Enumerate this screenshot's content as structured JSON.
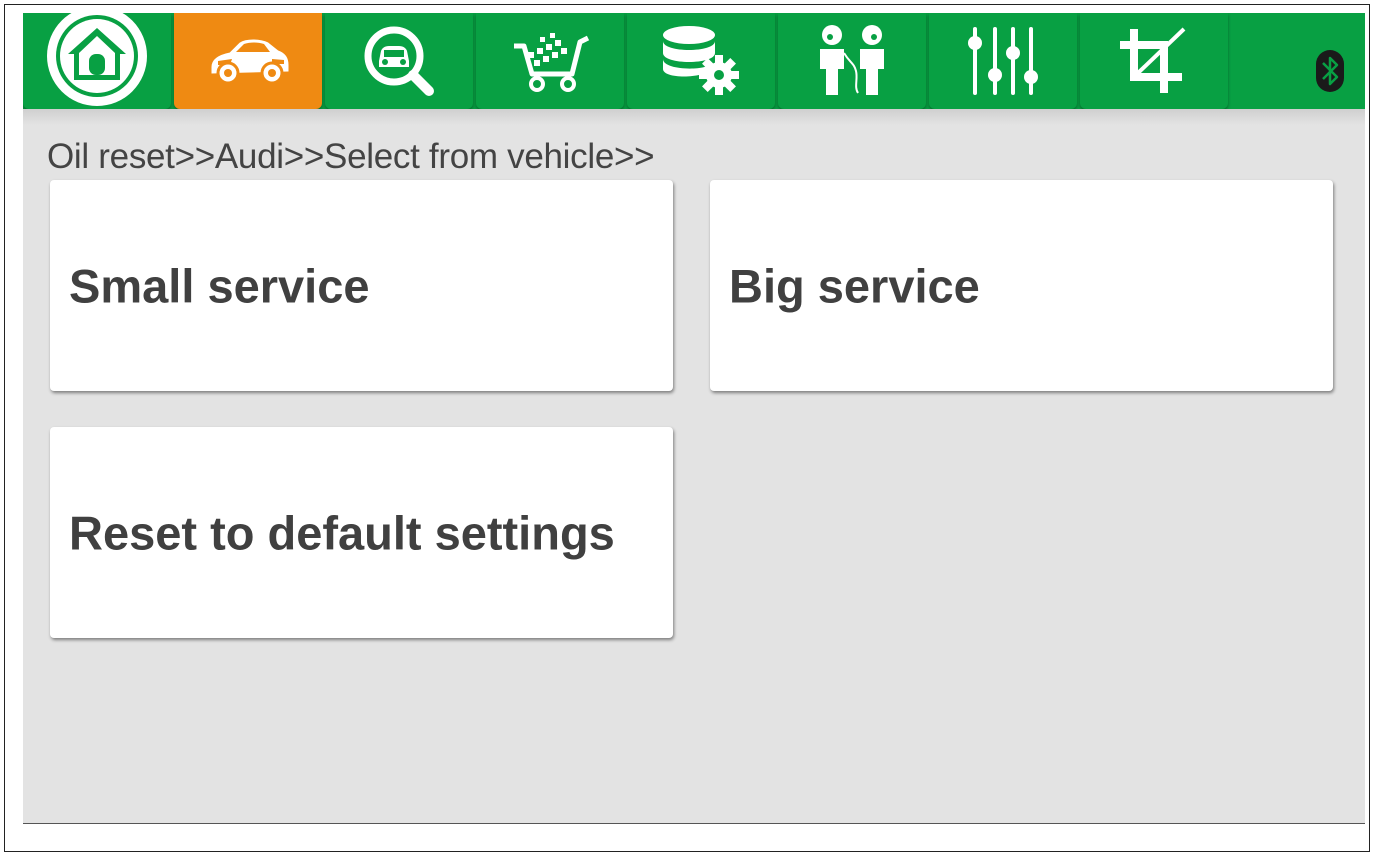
{
  "toolbar": {
    "tabs": [
      {
        "name": "home-icon",
        "state": "normal"
      },
      {
        "name": "car-icon",
        "state": "active"
      },
      {
        "name": "car-search-icon",
        "state": "normal"
      },
      {
        "name": "shopping-cart-icon",
        "state": "normal"
      },
      {
        "name": "database-settings-icon",
        "state": "normal"
      },
      {
        "name": "people-talking-icon",
        "state": "normal"
      },
      {
        "name": "sliders-icon",
        "state": "normal"
      },
      {
        "name": "crop-icon",
        "state": "normal"
      },
      {
        "name": "bluetooth-icon",
        "state": "normal"
      }
    ],
    "active_color": "#ef8a12",
    "bar_color": "#08a043"
  },
  "breadcrumb": "Oil reset>>Audi>>Select from vehicle>>",
  "options": [
    {
      "label": "Small service"
    },
    {
      "label": "Big service"
    },
    {
      "label": "Reset to default settings"
    }
  ]
}
